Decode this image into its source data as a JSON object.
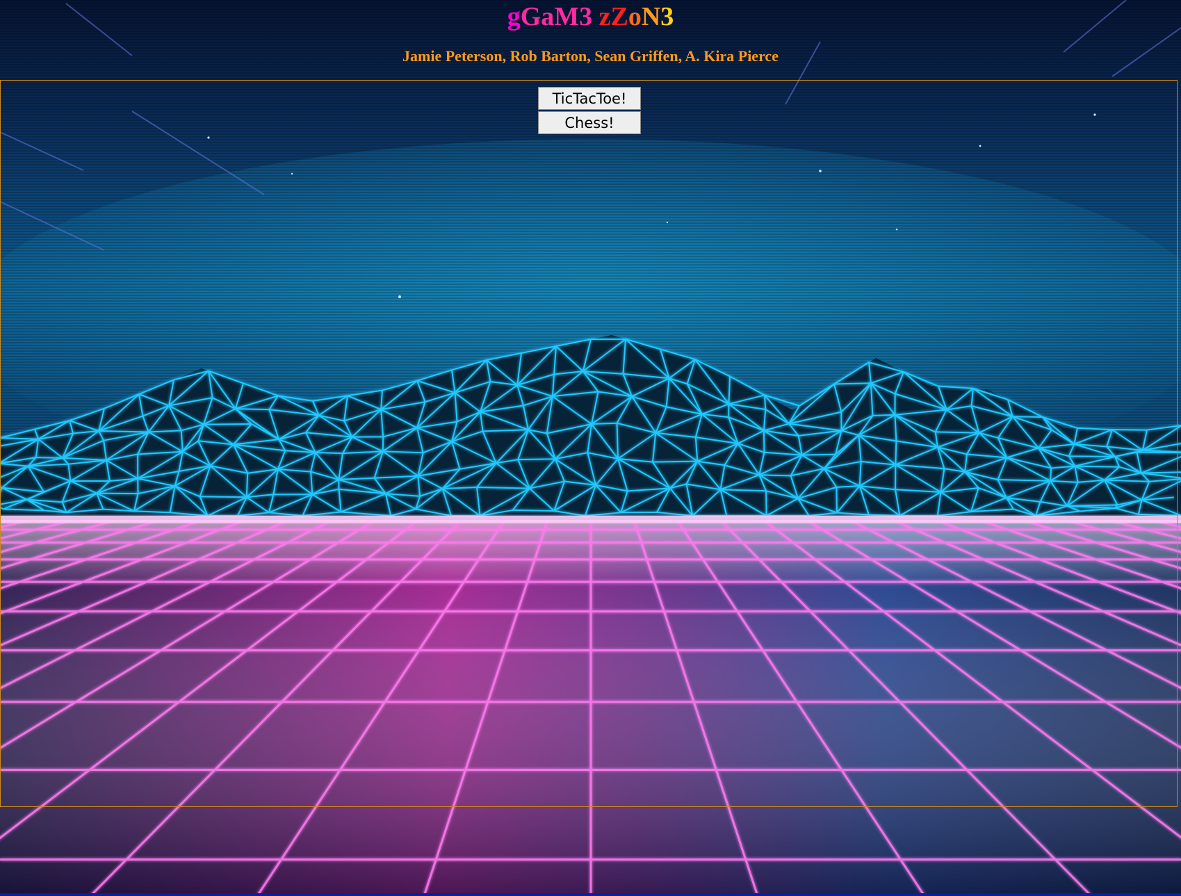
{
  "header": {
    "title_segments": [
      {
        "text": "g",
        "color": "#ff00cc"
      },
      {
        "text": "GaM3",
        "color": "#ff2a9e"
      },
      {
        "text": " ",
        "color": "#ff4040"
      },
      {
        "text": "zZ",
        "color": "#ff2020"
      },
      {
        "text": "o",
        "color": "#ff6a1a"
      },
      {
        "text": "N",
        "color": "#ff9a1a"
      },
      {
        "text": "3",
        "color": "#ffd21a"
      }
    ],
    "authors": "Jamie Peterson, Rob Barton, Sean Griffen, A. Kira Pierce",
    "authors_color": "#ff9a1a"
  },
  "menu": {
    "tictactoe_label": "TicTacToe!",
    "chess_label": "Chess!"
  },
  "theme": {
    "panel_border": "#d18a16",
    "grid_line": "#ff7cf0",
    "mountain_line": "#20c8ff",
    "sky_top": "#071735",
    "sky_mid": "#0b3e6e"
  }
}
